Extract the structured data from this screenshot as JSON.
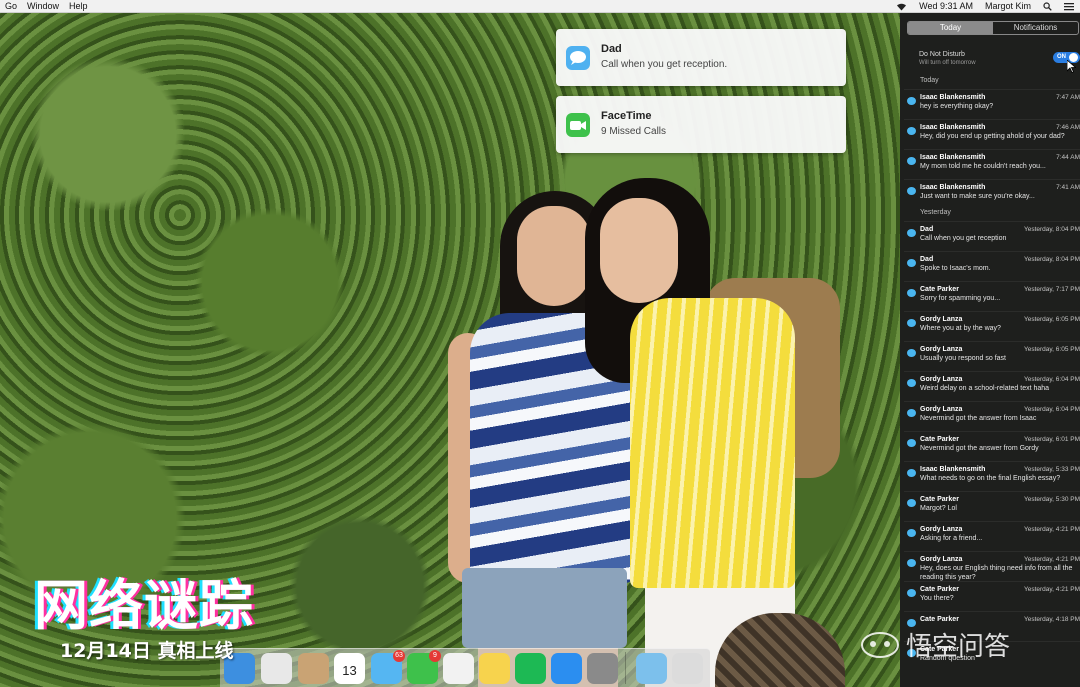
{
  "menu_bar": {
    "items": [
      "Go",
      "Window",
      "Help"
    ],
    "clock": "Wed 9:31 AM",
    "user": "Margot Kim"
  },
  "banners": [
    {
      "app": "Messages",
      "title": "Dad",
      "body": "Call when you get reception.",
      "icon": "messages-icon"
    },
    {
      "app": "FaceTime",
      "title": "FaceTime",
      "body": "9 Missed Calls",
      "icon": "facetime-icon"
    }
  ],
  "notification_center": {
    "tabs": [
      "Today",
      "Notifications"
    ],
    "active_tab": "Today",
    "dnd": {
      "label": "Do Not Disturb",
      "sub": "Will turn off tomorrow",
      "state": "ON"
    },
    "sections": [
      {
        "heading": "Today",
        "items": [
          {
            "sender": "Isaac Blankensmith",
            "time": "7:47 AM",
            "message": "hey is everything okay?"
          },
          {
            "sender": "Isaac Blankensmith",
            "time": "7:46 AM",
            "message": "Hey, did you end up getting ahold of your dad?"
          },
          {
            "sender": "Isaac Blankensmith",
            "time": "7:44 AM",
            "message": "My mom told me he couldn't reach you..."
          },
          {
            "sender": "Isaac Blankensmith",
            "time": "7:41 AM",
            "message": "Just want to make sure you're okay..."
          }
        ]
      },
      {
        "heading": "Yesterday",
        "items": [
          {
            "sender": "Dad",
            "time": "Yesterday, 8:04 PM",
            "message": "Call when you get reception"
          },
          {
            "sender": "Dad",
            "time": "Yesterday, 8:04 PM",
            "message": "Spoke to Isaac's mom."
          },
          {
            "sender": "Cate Parker",
            "time": "Yesterday, 7:17 PM",
            "message": "Sorry for spamming you..."
          },
          {
            "sender": "Gordy Lanza",
            "time": "Yesterday, 6:05 PM",
            "message": "Where you at by the way?"
          },
          {
            "sender": "Gordy Lanza",
            "time": "Yesterday, 6:05 PM",
            "message": "Usually you respond so fast"
          },
          {
            "sender": "Gordy Lanza",
            "time": "Yesterday, 6:04 PM",
            "message": "Weird delay on a school-related text haha"
          },
          {
            "sender": "Gordy Lanza",
            "time": "Yesterday, 6:04 PM",
            "message": "Nevermind got the answer from Isaac"
          },
          {
            "sender": "Cate Parker",
            "time": "Yesterday, 6:01 PM",
            "message": "Nevermind got the answer from Gordy"
          },
          {
            "sender": "Isaac Blankensmith",
            "time": "Yesterday, 5:33 PM",
            "message": "What needs to go on the final English essay?"
          },
          {
            "sender": "Cate Parker",
            "time": "Yesterday, 5:30 PM",
            "message": "Margot? Lol"
          },
          {
            "sender": "Gordy Lanza",
            "time": "Yesterday, 4:21 PM",
            "message": "Asking for a friend..."
          },
          {
            "sender": "Gordy Lanza",
            "time": "Yesterday, 4:21 PM",
            "message": "Hey, does our English thing need info from all the reading this year?"
          },
          {
            "sender": "Cate Parker",
            "time": "Yesterday, 4:21 PM",
            "message": "You there?"
          },
          {
            "sender": "Cate Parker",
            "time": "Yesterday, 4:18 PM",
            "message": ""
          },
          {
            "sender": "Cate Parker",
            "time": "",
            "message": "Random question"
          }
        ]
      }
    ]
  },
  "dock": {
    "apps": [
      {
        "name": "finder-icon",
        "color": "#3d8fe0"
      },
      {
        "name": "chrome-icon",
        "color": "#e8e8e8"
      },
      {
        "name": "contacts-icon",
        "color": "#c9a374"
      },
      {
        "name": "calendar-icon",
        "color": "#ffffff",
        "label": "13"
      },
      {
        "name": "messages-icon",
        "color": "#55b6f2",
        "badge": "63"
      },
      {
        "name": "facetime-icon",
        "color": "#3ec14b",
        "badge": "9"
      },
      {
        "name": "photos-icon",
        "color": "#f2f2f2"
      },
      {
        "name": "notes-icon",
        "color": "#f7d34d"
      },
      {
        "name": "spotify-icon",
        "color": "#1db954"
      },
      {
        "name": "app-store-icon",
        "color": "#2b8ef0"
      },
      {
        "name": "system-preferences-icon",
        "color": "#8a8a8a"
      },
      {
        "name": "downloads-folder-icon",
        "color": "#7cc0ec"
      },
      {
        "name": "trash-icon",
        "color": "#dcdcdc"
      }
    ]
  },
  "overlay": {
    "title": "网络谜踪",
    "date": "12月14日 真相上线",
    "watermark": "悟空问答"
  }
}
